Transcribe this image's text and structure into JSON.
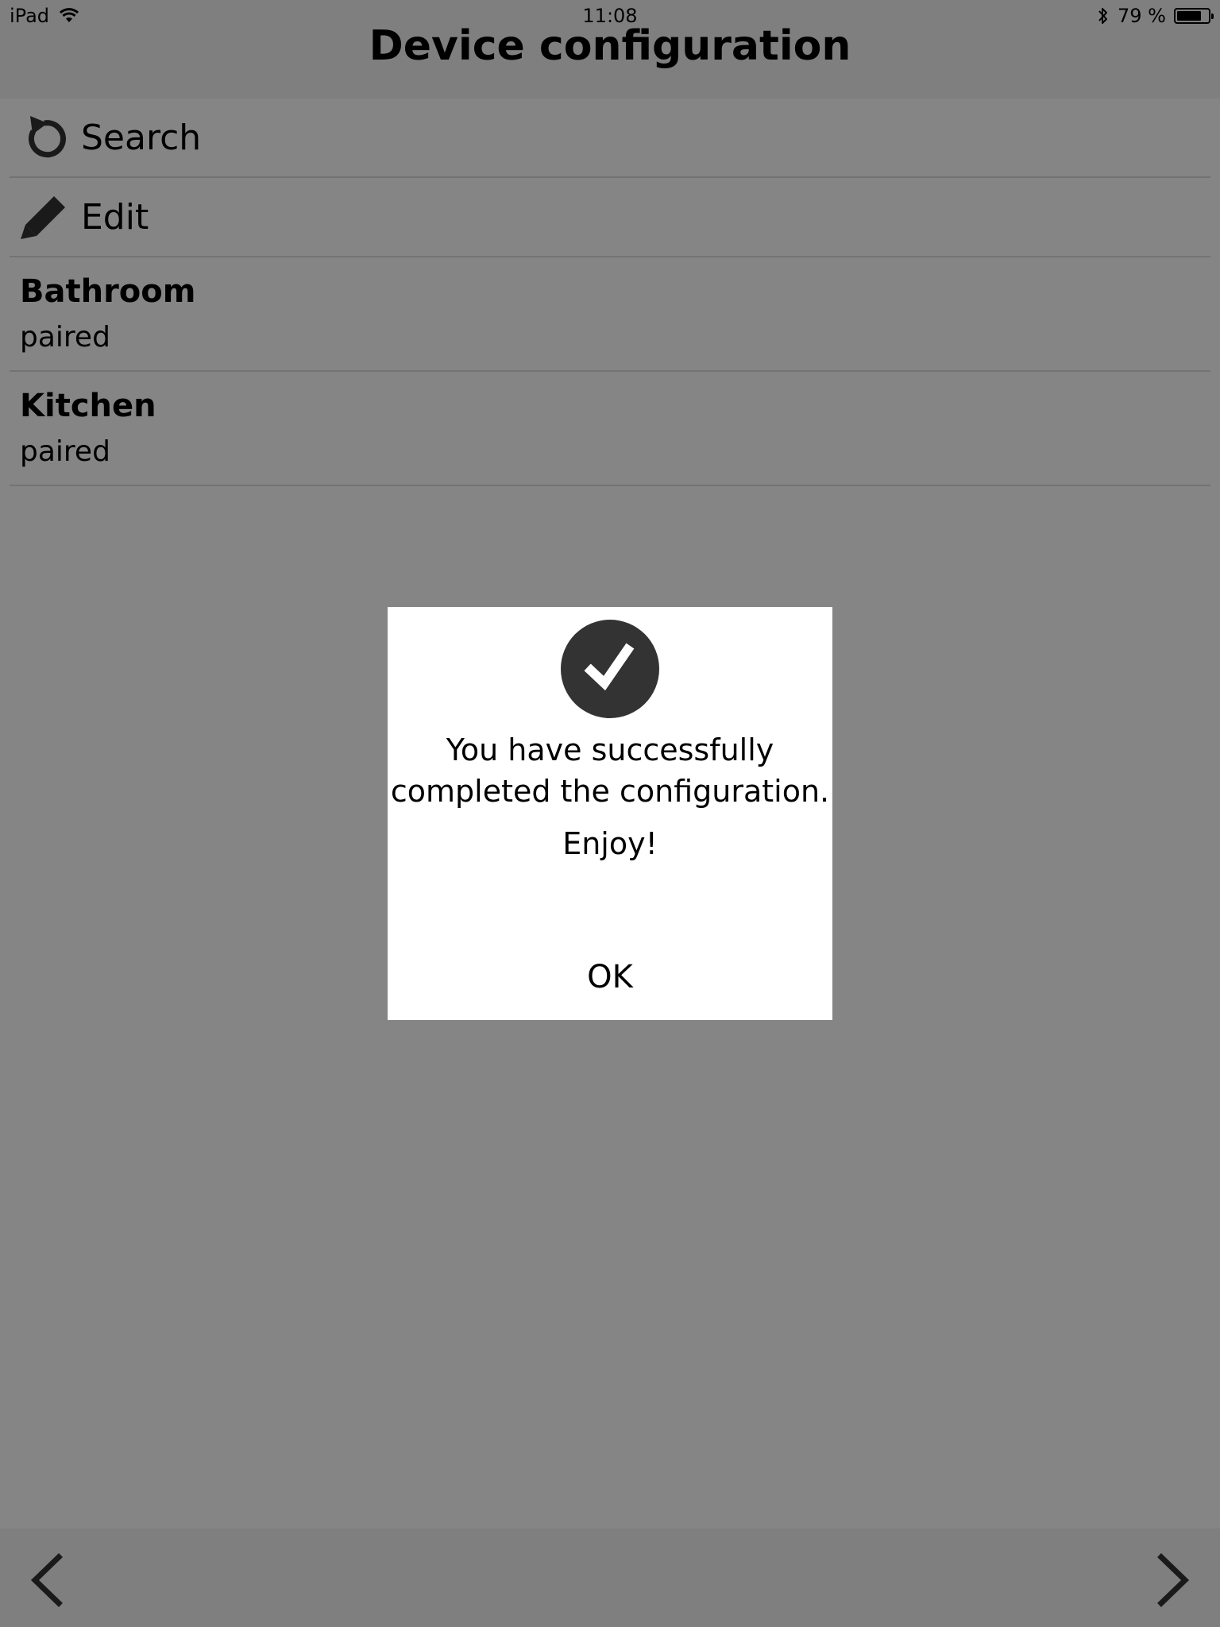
{
  "status_bar": {
    "device": "iPad",
    "time": "11:08",
    "battery": "79 %",
    "battery_level": 0.79,
    "icons": [
      "wifi-icon",
      "bluetooth-icon",
      "battery-icon"
    ]
  },
  "header": {
    "title": "Device configuration"
  },
  "actions": [
    {
      "label": "Search",
      "icon": "refresh-icon"
    },
    {
      "label": "Edit",
      "icon": "pencil-icon"
    }
  ],
  "devices": [
    {
      "name": "Bathroom",
      "status": "paired"
    },
    {
      "name": "Kitchen",
      "status": "paired"
    }
  ],
  "dialog": {
    "icon": "checkmark-icon",
    "message": "You have successfully completed the configuration.",
    "sub": "Enjoy!",
    "ok_label": "OK"
  },
  "footer": {
    "icons": [
      "back-arrow-icon",
      "forward-arrow-icon"
    ]
  },
  "colors": {
    "overlay": "#808080",
    "dialog_bg": "#ffffff",
    "icon_dark": "#333333",
    "text": "#000000"
  }
}
